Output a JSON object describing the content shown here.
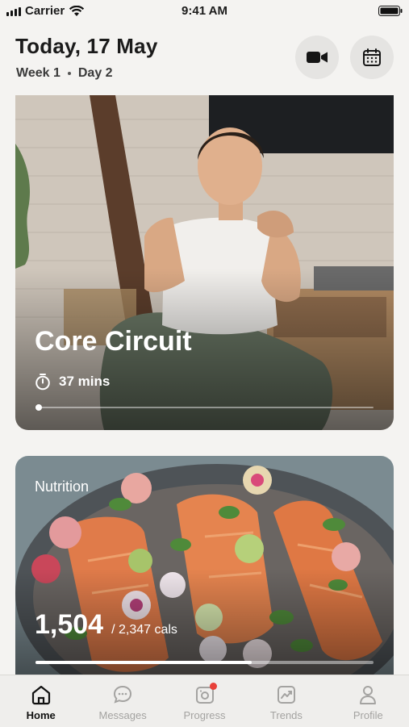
{
  "status_bar": {
    "carrier": "Carrier",
    "time": "9:41 AM"
  },
  "header": {
    "title": "Today, 17 May",
    "week": "Week 1",
    "day": "Day 2",
    "icons": [
      "video-camera-icon",
      "calendar-icon"
    ]
  },
  "workout": {
    "title": "Core Circuit",
    "duration": "37 mins",
    "progress_fraction": 0.01
  },
  "nutrition": {
    "label": "Nutrition",
    "consumed": "1,504",
    "goal": "/ 2,347 cals",
    "progress_fraction": 0.64
  },
  "tabs": [
    {
      "label": "Home",
      "icon": "home-icon",
      "active": true
    },
    {
      "label": "Messages",
      "icon": "chat-icon",
      "active": false
    },
    {
      "label": "Progress",
      "icon": "progress-camera-icon",
      "active": false,
      "has_notification": true
    },
    {
      "label": "Trends",
      "icon": "trend-chart-icon",
      "active": false
    },
    {
      "label": "Profile",
      "icon": "person-icon",
      "active": false
    }
  ],
  "colors": {
    "accent_notification": "#e8413a",
    "tab_active": "#111111",
    "tab_inactive": "#a4a3a1"
  }
}
